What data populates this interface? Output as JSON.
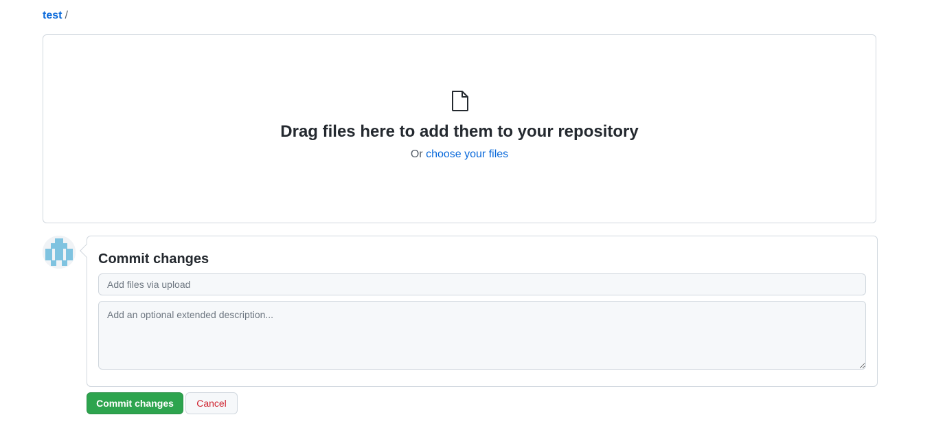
{
  "breadcrumb": {
    "repo": "test",
    "separator": "/"
  },
  "dropzone": {
    "icon": "file-icon",
    "title": "Drag files here to add them to your repository",
    "or_text": "Or",
    "choose_link": "choose your files"
  },
  "commit": {
    "avatar_icon": "identicon-avatar",
    "title": "Commit changes",
    "summary_placeholder": "Add files via upload",
    "summary_value": "",
    "description_placeholder": "Add an optional extended description...",
    "description_value": ""
  },
  "actions": {
    "commit_label": "Commit changes",
    "cancel_label": "Cancel"
  },
  "colors": {
    "link": "#0969da",
    "commit_button": "#2da44e",
    "cancel_text": "#cf222e",
    "avatar": "#7fc3e0",
    "border": "#d0d7de"
  }
}
